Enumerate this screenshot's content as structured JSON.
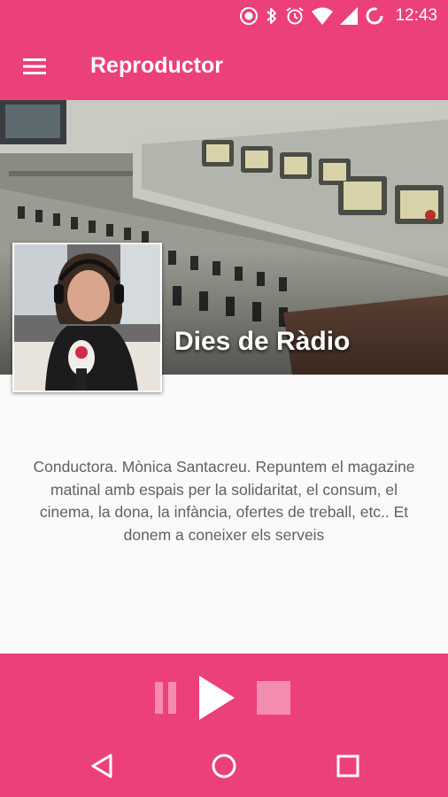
{
  "status_bar": {
    "time": "12:43",
    "icons": [
      "cast-icon",
      "bluetooth-icon",
      "alarm-icon",
      "wifi-icon",
      "signal-icon",
      "sync-icon"
    ]
  },
  "app_bar": {
    "title": "Reproductor",
    "menu_icon": "menu-icon"
  },
  "program": {
    "name": "Dies de Ràdio",
    "description": "Conductora. Mònica Santacreu. Repuntem el magazine matinal amb espais per la solidaritat, el consum, el cinema, la dona, la infància, ofertes de treball, etc.. Et donem a coneixer els serveis"
  },
  "player": {
    "pause_icon": "pause-icon",
    "play_icon": "play-icon",
    "stop_icon": "stop-icon"
  },
  "nav": {
    "back_icon": "back-icon",
    "home_icon": "home-icon",
    "recents_icon": "recents-icon"
  },
  "colors": {
    "primary": "#ec407a",
    "text": "#616161"
  }
}
